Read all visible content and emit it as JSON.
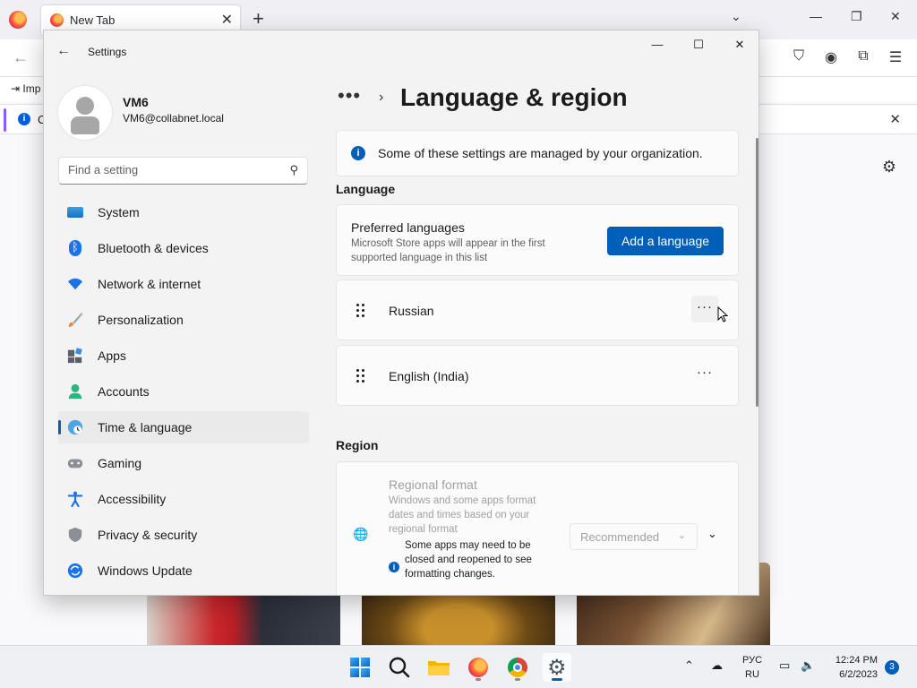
{
  "browser": {
    "tab_title": "New Tab",
    "tab_close": "✕",
    "new_tab": "+",
    "import_text": "Imp",
    "infobar_text": "C"
  },
  "settings": {
    "app_title": "Settings",
    "profile": {
      "name": "VM6",
      "email": "VM6@collabnet.local"
    },
    "search": {
      "placeholder": "Find a setting"
    },
    "nav": [
      {
        "label": "System",
        "icon": "display-icon"
      },
      {
        "label": "Bluetooth & devices",
        "icon": "bluetooth-icon"
      },
      {
        "label": "Network & internet",
        "icon": "wifi-icon"
      },
      {
        "label": "Personalization",
        "icon": "brush-icon"
      },
      {
        "label": "Apps",
        "icon": "apps-icon"
      },
      {
        "label": "Accounts",
        "icon": "person-icon"
      },
      {
        "label": "Time & language",
        "icon": "globe-clock-icon",
        "active": true
      },
      {
        "label": "Gaming",
        "icon": "gamepad-icon"
      },
      {
        "label": "Accessibility",
        "icon": "accessibility-icon"
      },
      {
        "label": "Privacy & security",
        "icon": "shield-icon"
      },
      {
        "label": "Windows Update",
        "icon": "update-icon"
      }
    ],
    "breadcrumb": {
      "dots": "•••",
      "chevron": "›"
    },
    "page_title": "Language & region",
    "notice": "Some of these settings are managed by your organization.",
    "language_section": {
      "heading": "Language",
      "preferred_title": "Preferred languages",
      "preferred_desc": "Microsoft Store apps will appear in the first supported language in this list",
      "add_button": "Add a language",
      "languages": [
        "Russian",
        "English (India)"
      ],
      "more_label": "···"
    },
    "region_section": {
      "heading": "Region",
      "format_title": "Regional format",
      "format_desc": "Windows and some apps format dates and times based on your regional format",
      "format_note": "Some apps may need to be closed and reopened to see formatting changes.",
      "format_value": "Recommended"
    }
  },
  "taskbar": {
    "lang_top": "РУС",
    "lang_bottom": "RU",
    "time": "12:24 PM",
    "date": "6/2/2023",
    "notifications": "3"
  },
  "colors": {
    "accent": "#005fb8",
    "firefox_purple": "#9059ff"
  }
}
